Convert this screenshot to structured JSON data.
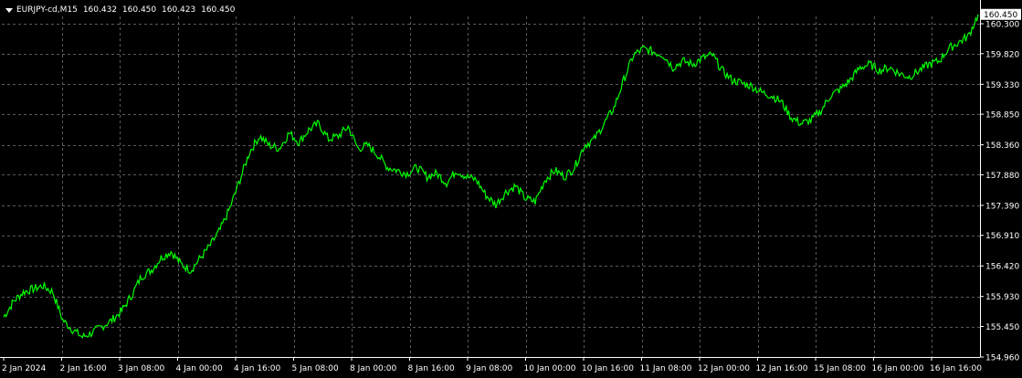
{
  "header": {
    "symbol_timeframe": "EURJPY-cd,M15",
    "open": "160.432",
    "high": "160.450",
    "low": "160.423",
    "close": "160.450"
  },
  "colors": {
    "background": "#000000",
    "grid": "#5a5a5a",
    "axis": "#ffffff",
    "line": "#00ff00",
    "text": "#ffffff",
    "price_tag_bg": "#ffffff",
    "price_tag_text": "#000000"
  },
  "chart_data": {
    "type": "line",
    "grid": true,
    "current_price": "160.450",
    "y_ticks": [
      "160.300",
      "159.820",
      "159.330",
      "158.850",
      "158.360",
      "157.880",
      "157.390",
      "156.910",
      "156.420",
      "155.930",
      "155.450",
      "154.960"
    ],
    "ylim": [
      154.96,
      160.45
    ],
    "x_ticks": [
      "2 Jan 2024",
      "2 Jan 16:00",
      "3 Jan 08:00",
      "4 Jan 00:00",
      "4 Jan 16:00",
      "5 Jan 08:00",
      "8 Jan 00:00",
      "8 Jan 16:00",
      "9 Jan 08:00",
      "10 Jan 00:00",
      "10 Jan 16:00",
      "11 Jan 08:00",
      "12 Jan 00:00",
      "12 Jan 16:00",
      "15 Jan 08:00",
      "16 Jan 00:00",
      "16 Jan 16:00"
    ],
    "series": [
      {
        "values": [
          155.6,
          155.85,
          156.0,
          156.05,
          156.1,
          156.0,
          155.55,
          155.4,
          155.28,
          155.35,
          155.45,
          155.55,
          155.7,
          155.95,
          156.25,
          156.35,
          156.55,
          156.65,
          156.45,
          156.35,
          156.55,
          156.75,
          157.0,
          157.35,
          157.8,
          158.25,
          158.5,
          158.35,
          158.3,
          158.55,
          158.4,
          158.6,
          158.7,
          158.45,
          158.5,
          158.65,
          158.3,
          158.35,
          158.2,
          158.0,
          157.95,
          157.9,
          158.0,
          157.85,
          157.9,
          157.75,
          157.95,
          157.85,
          157.8,
          157.55,
          157.4,
          157.6,
          157.7,
          157.5,
          157.45,
          157.8,
          157.95,
          157.85,
          158.0,
          158.35,
          158.45,
          158.7,
          158.95,
          159.4,
          159.8,
          159.9,
          159.85,
          159.8,
          159.6,
          159.7,
          159.65,
          159.75,
          159.8,
          159.55,
          159.4,
          159.35,
          159.3,
          159.2,
          159.15,
          159.05,
          158.8,
          158.7,
          158.75,
          158.9,
          159.15,
          159.25,
          159.4,
          159.6,
          159.65,
          159.55,
          159.6,
          159.5,
          159.45,
          159.55,
          159.65,
          159.7,
          159.9,
          160.0,
          160.1,
          160.45
        ]
      }
    ]
  }
}
